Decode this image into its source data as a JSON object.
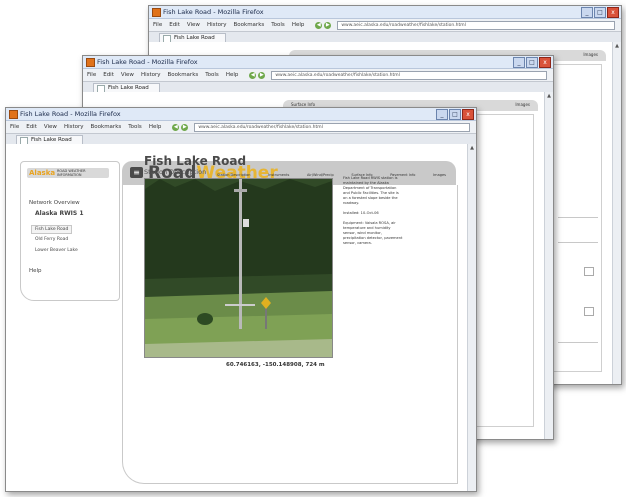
{
  "browser": {
    "window_title": "Fish Lake Road - Mozilla Firefox",
    "menu": [
      "File",
      "Edit",
      "View",
      "History",
      "Bookmarks",
      "Tools",
      "Help"
    ],
    "url": "www.aeic.alaska.edu/roadweather/fishlake/station.html",
    "tab_label": "Fish Lake Road",
    "window_buttons": [
      "_",
      "□",
      "x"
    ]
  },
  "sidebar": {
    "logo_word": "Alaska",
    "logo_subtitle": "ROAD WEATHER INFORMATION",
    "network_overview": "Network Overview",
    "network_name": "Alaska RWIS 1",
    "items": [
      "Fish Lake Road",
      "Old Ferry Road",
      "Lower Beaver Lake"
    ],
    "help": "Help"
  },
  "header": {
    "logo_road": "Road",
    "logo_weather": "Weather",
    "nav": [
      "Station Description",
      "Instruments",
      "Air/Wind/Precip",
      "Surface Info",
      "Pavement Info",
      "Images"
    ]
  },
  "page": {
    "title": "Fish Lake Road",
    "subtitle": "Station Description",
    "description": [
      "Fish Lake Road RWIS station is maintained by the Alaska Department of Transportation and Public Facilities. The site is on a forested slope beside the roadway.",
      "Installed: 10-Oct-06",
      "Equipment: Vaisala ROSA, air temperature and humidity sensor, wind monitor, precipitation detector, pavement sensor, camera."
    ],
    "coords": "60.746163, -150.148908, 724 m"
  },
  "colors": {
    "accent_yellow": "#e7b533",
    "header_gray": "#c9c9c9",
    "titlebar_blue": "#dfe9f7",
    "close_red": "#d9523a"
  }
}
